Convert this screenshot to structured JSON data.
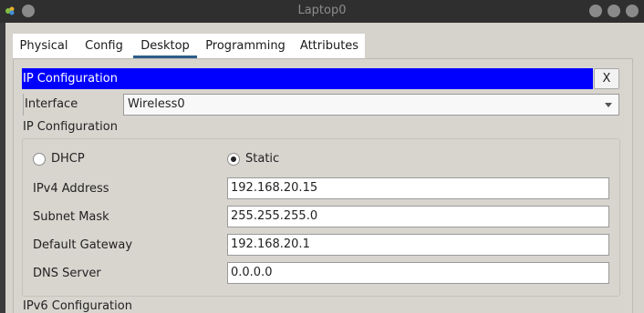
{
  "window": {
    "title": "Laptop0"
  },
  "tabs": [
    {
      "label": "Physical"
    },
    {
      "label": "Config"
    },
    {
      "label": "Desktop"
    },
    {
      "label": "Programming"
    },
    {
      "label": "Attributes"
    }
  ],
  "active_tab": "Desktop",
  "panel": {
    "title": "IP Configuration",
    "close_label": "X"
  },
  "interface": {
    "label": "Interface",
    "value": "Wireless0"
  },
  "ipv4_section": {
    "title": "IP Configuration",
    "mode_options": [
      {
        "label": "DHCP",
        "selected": false
      },
      {
        "label": "Static",
        "selected": true
      }
    ],
    "fields": [
      {
        "label": "IPv4 Address",
        "value": "192.168.20.15"
      },
      {
        "label": "Subnet Mask",
        "value": "255.255.255.0"
      },
      {
        "label": "Default Gateway",
        "value": "192.168.20.1"
      },
      {
        "label": "DNS Server",
        "value": "0.0.0.0"
      }
    ]
  },
  "ipv6_section": {
    "title": "IPv6 Configuration"
  },
  "colors": {
    "header_bg": "#0000ff",
    "tab_underline": "#2d5d8a"
  }
}
